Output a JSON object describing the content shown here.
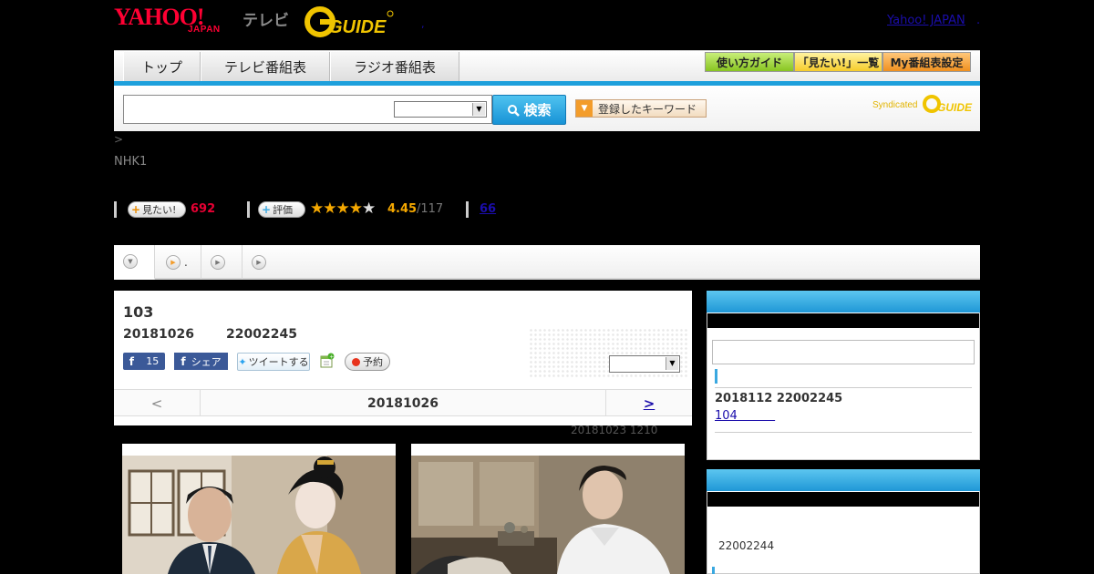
{
  "header": {
    "logo_yahoo": "YAHOO!",
    "logo_japan": "JAPAN",
    "logo_tv": "テレビ",
    "logo_gguide": "G GUIDE",
    "yahoo_link": "Yahoo! JAPAN",
    "link_dot": ".",
    "mid_dot": ","
  },
  "nav": {
    "tabs": [
      "トップ",
      "テレビ番組表",
      "ラジオ番組表"
    ],
    "guide_button": "使い方ガイド",
    "want_list_button": "「見たい!」一覧",
    "my_schedule_button": "My番組表設定"
  },
  "search": {
    "button_label": "検索",
    "keyword_button": "登録したキーワード",
    "syndicated": "Syndicated",
    "syndicated_logo": "G GUIDE"
  },
  "breadcrumb": ">",
  "channel": "NHK1",
  "stats": {
    "want_label": "見たい!",
    "want_count": "692",
    "rating_label": "評価",
    "rating_value": "4.45",
    "rating_count": "/117",
    "rating_stars": 4.45,
    "comment_count": "66"
  },
  "tabs2": [
    "",
    ".",
    "",
    ""
  ],
  "program": {
    "title": "103",
    "date": "20181026",
    "time": "22002245",
    "fb_count": "15",
    "fb_share": "シェア",
    "tweet": "ツイートする",
    "reserve": "予約",
    "pager_prev": "<",
    "pager_date": "20181026",
    "pager_next": ">",
    "update_note": "20181023  1210"
  },
  "sidebar": {
    "next_date": "2018112  22002245",
    "next_link": "104          ",
    "prev_time": "22002244"
  },
  "colors": {
    "accent": "#1ea0dc",
    "want_count": "#e60033",
    "rating": "#f5a800",
    "link": "#1a0dab"
  }
}
